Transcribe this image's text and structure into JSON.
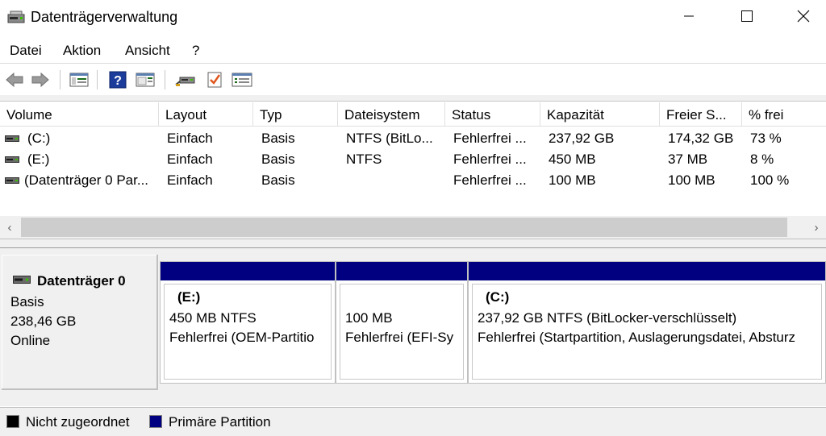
{
  "window": {
    "title": "Datenträgerverwaltung",
    "controls": {
      "minimize": "minimize",
      "maximize": "maximize",
      "close": "close"
    }
  },
  "menu": [
    "Datei",
    "Aktion",
    "Ansicht",
    "?"
  ],
  "toolbar": {
    "buttons": [
      "back-icon",
      "forward-icon",
      "console-tree-icon",
      "help-icon",
      "console-view-icon",
      "connect-drive-icon",
      "checklist-icon",
      "properties-list-icon"
    ]
  },
  "volume_list": {
    "columns": [
      "Volume",
      "Layout",
      "Typ",
      "Dateisystem",
      "Status",
      "Kapazität",
      "Freier S...",
      "% frei"
    ],
    "rows": [
      {
        "volume": "(C:)",
        "layout": "Einfach",
        "typ": "Basis",
        "dateisystem": "NTFS (BitLo...",
        "status": "Fehlerfrei ...",
        "kapazitaet": "237,92 GB",
        "frei": "174,32 GB",
        "prozent": "73 %"
      },
      {
        "volume": "(E:)",
        "layout": "Einfach",
        "typ": "Basis",
        "dateisystem": "NTFS",
        "status": "Fehlerfrei ...",
        "kapazitaet": "450 MB",
        "frei": "37 MB",
        "prozent": "8 %"
      },
      {
        "volume": "(Datenträger 0 Par...",
        "layout": "Einfach",
        "typ": "Basis",
        "dateisystem": "",
        "status": "Fehlerfrei ...",
        "kapazitaet": "100 MB",
        "frei": "100 MB",
        "prozent": "100 %"
      }
    ],
    "scroll_left": "‹",
    "scroll_right": "›"
  },
  "disk": {
    "name": "Datenträger 0",
    "type": "Basis",
    "size": "238,46 GB",
    "state": "Online",
    "partitions": [
      {
        "title": "(E:)",
        "line1": "450 MB NTFS",
        "line2": "Fehlerfrei (OEM-Partitio"
      },
      {
        "title": "",
        "line1": "100 MB",
        "line2": "Fehlerfrei (EFI-Sy"
      },
      {
        "title": "(C:)",
        "line1": "237,92 GB NTFS (BitLocker-verschlüsselt)",
        "line2": "Fehlerfrei (Startpartition, Auslagerungsdatei, Absturz"
      }
    ]
  },
  "legend": [
    {
      "label": "Nicht zugeordnet",
      "color": "#000000"
    },
    {
      "label": "Primäre Partition",
      "color": "#000080"
    }
  ],
  "colors": {
    "primary_partition": "#000080",
    "unallocated": "#000000"
  }
}
